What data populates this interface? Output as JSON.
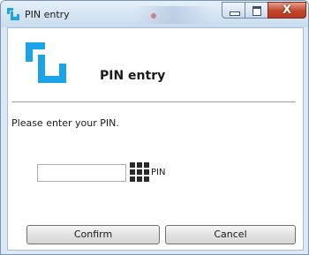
{
  "window": {
    "title": "PIN entry",
    "minimize_icon": "minimize-icon",
    "maximize_icon": "maximize-icon",
    "close_icon": "close-icon",
    "close_glyph": "X"
  },
  "header": {
    "title": "PIN entry",
    "logo_icon": "app-logo-icon",
    "accent_color": "#1aa3e8"
  },
  "form": {
    "prompt": "Please enter your PIN.",
    "pin_value": "",
    "keypad_icon": "keypad-grid-icon",
    "pin_label": "PIN"
  },
  "buttons": {
    "confirm_label": "Confirm",
    "cancel_label": "Cancel"
  }
}
